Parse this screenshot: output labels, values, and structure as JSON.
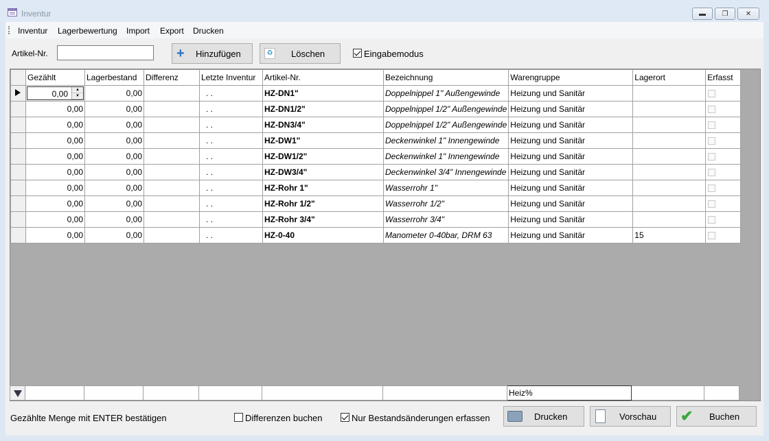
{
  "window": {
    "title": "Inventur"
  },
  "menu": [
    "Inventur",
    "Lagerbewertung",
    "Import",
    "Export",
    "Drucken"
  ],
  "toolbar": {
    "artikel_label": "Artikel-Nr.",
    "artikel_value": "",
    "add_label": "Hinzufügen",
    "delete_label": "Löschen",
    "eingabemodus_label": "Eingabemodus",
    "eingabemodus_checked": true
  },
  "grid": {
    "columns": [
      "Gezählt",
      "Lagerbestand",
      "Differenz",
      "Letzte Inventur",
      "Artikel-Nr.",
      "Bezeichnung",
      "Warengruppe",
      "Lagerort",
      "Erfasst"
    ],
    "rows": [
      {
        "gezaehlt": "0,00",
        "lagerbestand": "0,00",
        "differenz": "",
        "letzte": ". .",
        "artikel": "HZ-DN1\"",
        "bezeichnung": "Doppelnippel 1\" Außengewinde",
        "warengruppe": "Heizung und Sanitär",
        "lagerort": ""
      },
      {
        "gezaehlt": "0,00",
        "lagerbestand": "0,00",
        "differenz": "",
        "letzte": ". .",
        "artikel": "HZ-DN1/2\"",
        "bezeichnung": "Doppelnippel 1/2\" Außengewinde",
        "warengruppe": "Heizung und Sanitär",
        "lagerort": ""
      },
      {
        "gezaehlt": "0,00",
        "lagerbestand": "0,00",
        "differenz": "",
        "letzte": ". .",
        "artikel": "HZ-DN3/4\"",
        "bezeichnung": "Doppelnippel 1/2\" Außengewinde",
        "warengruppe": "Heizung und Sanitär",
        "lagerort": ""
      },
      {
        "gezaehlt": "0,00",
        "lagerbestand": "0,00",
        "differenz": "",
        "letzte": ". .",
        "artikel": "HZ-DW1\"",
        "bezeichnung": "Deckenwinkel 1\" Innengewinde",
        "warengruppe": "Heizung und Sanitär",
        "lagerort": ""
      },
      {
        "gezaehlt": "0,00",
        "lagerbestand": "0,00",
        "differenz": "",
        "letzte": ". .",
        "artikel": "HZ-DW1/2\"",
        "bezeichnung": "Deckenwinkel 1\" Innengewinde",
        "warengruppe": "Heizung und Sanitär",
        "lagerort": ""
      },
      {
        "gezaehlt": "0,00",
        "lagerbestand": "0,00",
        "differenz": "",
        "letzte": ". .",
        "artikel": "HZ-DW3/4\"",
        "bezeichnung": "Deckenwinkel 3/4\" Innengewinde",
        "warengruppe": "Heizung und Sanitär",
        "lagerort": ""
      },
      {
        "gezaehlt": "0,00",
        "lagerbestand": "0,00",
        "differenz": "",
        "letzte": ". .",
        "artikel": "HZ-Rohr 1\"",
        "bezeichnung": "Wasserrohr 1\"",
        "warengruppe": "Heizung und Sanitär",
        "lagerort": ""
      },
      {
        "gezaehlt": "0,00",
        "lagerbestand": "0,00",
        "differenz": "",
        "letzte": ". .",
        "artikel": "HZ-Rohr 1/2\"",
        "bezeichnung": "Wasserrohr 1/2\"",
        "warengruppe": "Heizung und Sanitär",
        "lagerort": ""
      },
      {
        "gezaehlt": "0,00",
        "lagerbestand": "0,00",
        "differenz": "",
        "letzte": ". .",
        "artikel": "HZ-Rohr 3/4\"",
        "bezeichnung": "Wasserrohr 3/4\"",
        "warengruppe": "Heizung und Sanitär",
        "lagerort": ""
      },
      {
        "gezaehlt": "0,00",
        "lagerbestand": "0,00",
        "differenz": "",
        "letzte": ". .",
        "artikel": "HZ-0-40",
        "bezeichnung": "Manometer 0-40bar, DRM 63",
        "warengruppe": "Heizung und Sanitär",
        "lagerort": "15"
      }
    ]
  },
  "filter": {
    "warengruppe": "Heiz%"
  },
  "footer": {
    "status": "Gezählte Menge mit ENTER bestätigen",
    "differenzen_label": "Differenzen buchen",
    "differenzen_checked": false,
    "nur_bestand_label": "Nur Bestandsänderungen erfassen",
    "nur_bestand_checked": true,
    "drucken_label": "Drucken",
    "vorschau_label": "Vorschau",
    "buchen_label": "Buchen"
  }
}
